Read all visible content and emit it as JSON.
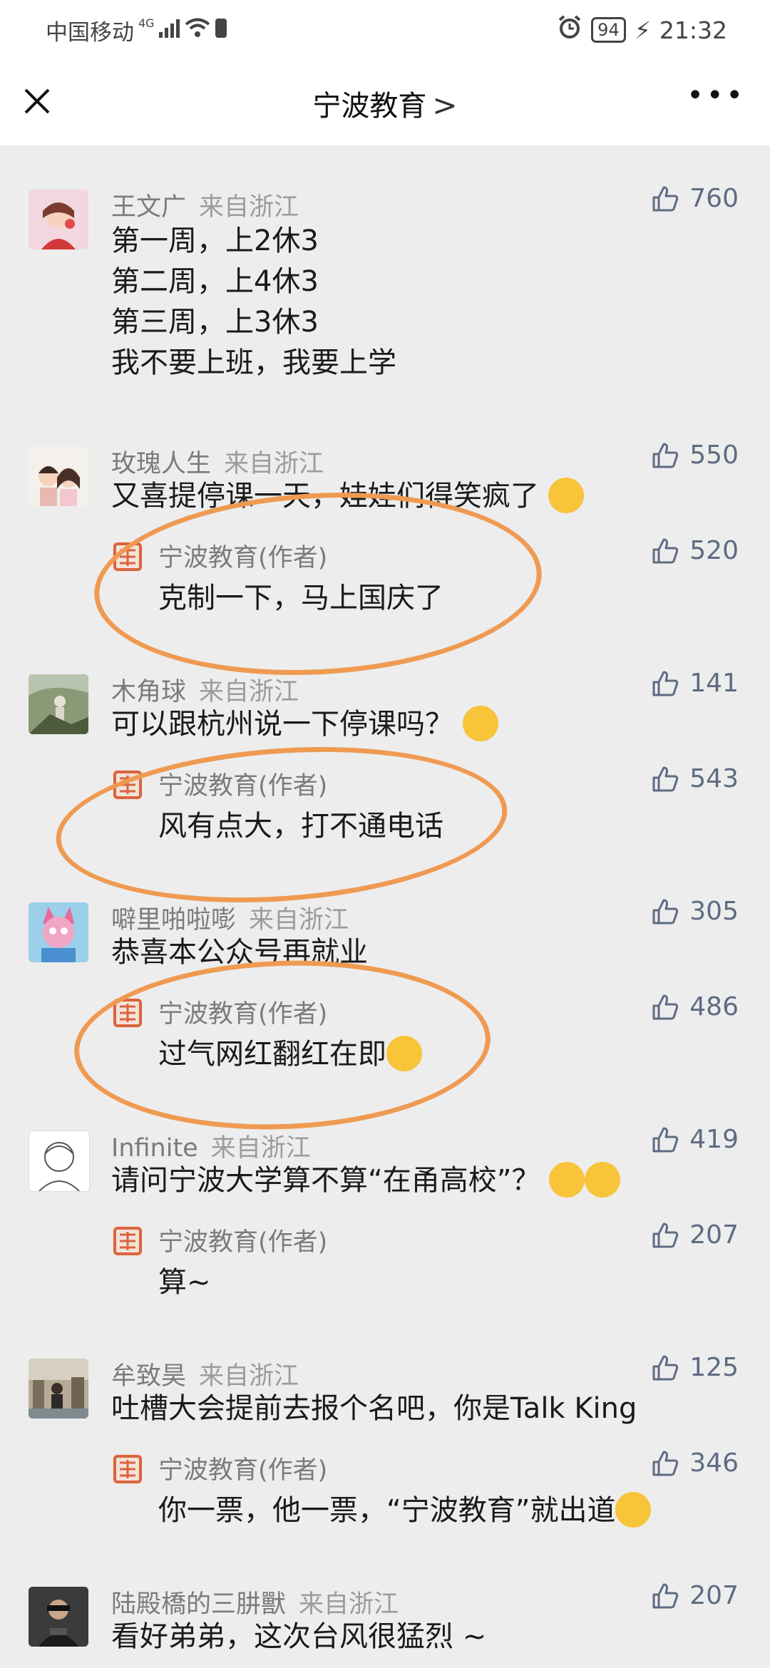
{
  "status_bar": {
    "carrier": "中国移动",
    "signal_type": "4G",
    "battery": "94",
    "time": "21:32"
  },
  "nav": {
    "title": "宁波教育",
    "chevron": ">",
    "more": "•••"
  },
  "colors": {
    "accent_orange": "#ef9a52",
    "like_blue": "#5e6b82",
    "background": "#ededed"
  },
  "comments": [
    {
      "name": "王文广",
      "location": "来自浙江",
      "text": "第一周，上2休3\n第二周，上4休3\n第三周，上3休3\n我不要上班，我要上学",
      "likes": "760",
      "avatar_icon": "cartoon-girl-avatar"
    },
    {
      "name": "玫瑰人生",
      "location": "来自浙江",
      "text": "又喜提停课一天，娃娃们得笑疯了",
      "likes": "550",
      "avatar_icon": "couple-avatar",
      "reply": {
        "name": "宁波教育(作者)",
        "text": "克制一下，马上国庆了",
        "likes": "520"
      }
    },
    {
      "name": "木角球",
      "location": "来自浙江",
      "text": "可以跟杭州说一下停课吗？",
      "likes": "141",
      "avatar_icon": "photo-avatar",
      "reply": {
        "name": "宁波教育(作者)",
        "text": "风有点大，打不通电话",
        "likes": "543"
      }
    },
    {
      "name": "噼里啪啦嘭",
      "location": "来自浙江",
      "text": "恭喜本公众号再就业",
      "likes": "305",
      "avatar_icon": "cartoon-avatar",
      "reply": {
        "name": "宁波教育(作者)",
        "text": "过气网红翻红在即",
        "likes": "486"
      }
    },
    {
      "name": "Infinite",
      "location": "来自浙江",
      "text": "请问宁波大学算不算“在甬高校”？",
      "likes": "419",
      "avatar_icon": "sketch-avatar",
      "reply": {
        "name": "宁波教育(作者)",
        "text": "算~",
        "likes": "207"
      }
    },
    {
      "name": "牟致昊",
      "location": "来自浙江",
      "text": "吐槽大会提前去报个名吧，你是Talk King",
      "likes": "125",
      "avatar_icon": "street-photo-avatar",
      "reply": {
        "name": "宁波教育(作者)",
        "text": "你一票，他一票，“宁波教育”就出道",
        "likes": "346"
      }
    },
    {
      "name": "陆殿橋的三肼獸",
      "location": "来自浙江",
      "text": "看好弟弟，这次台风很猛烈 ~",
      "likes": "207",
      "avatar_icon": "person-photo-avatar"
    }
  ]
}
